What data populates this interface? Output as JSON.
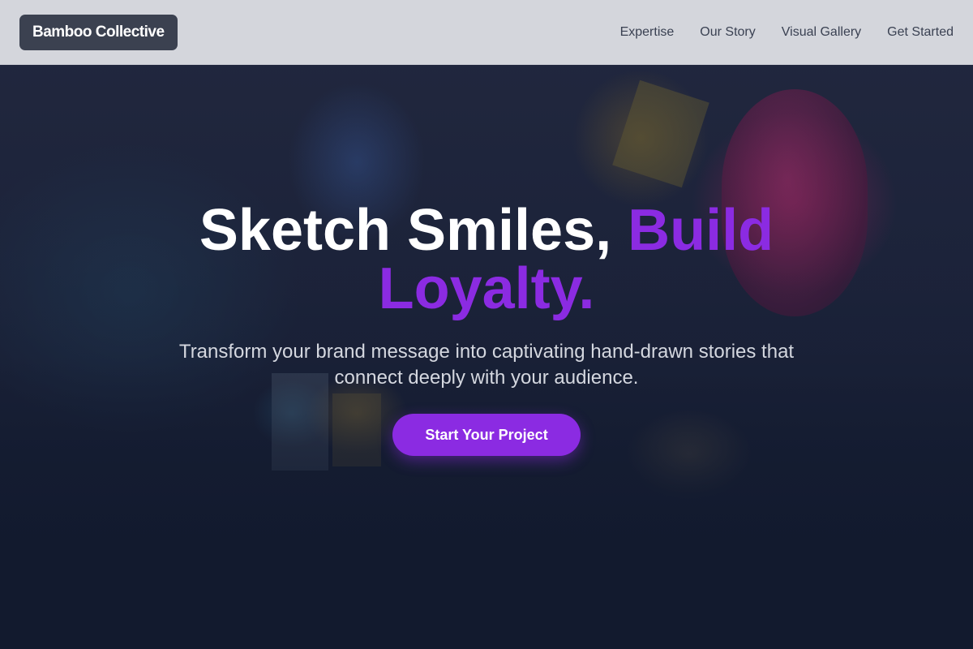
{
  "header": {
    "brand": "Bamboo Collective",
    "nav": [
      "Expertise",
      "Our Story",
      "Visual Gallery",
      "Get Started"
    ]
  },
  "hero": {
    "headline_white": "Sketch Smiles, ",
    "headline_accent": "Build Loyalty.",
    "subheading": "Transform your brand message into captivating hand-drawn stories that connect deeply with your audience.",
    "cta_label": "Start Your Project"
  },
  "colors": {
    "accent": "#8b2be2",
    "header_bg": "#e2e4e8",
    "brand_bg": "#3b4150",
    "hero_bottom": "#121a2e"
  }
}
